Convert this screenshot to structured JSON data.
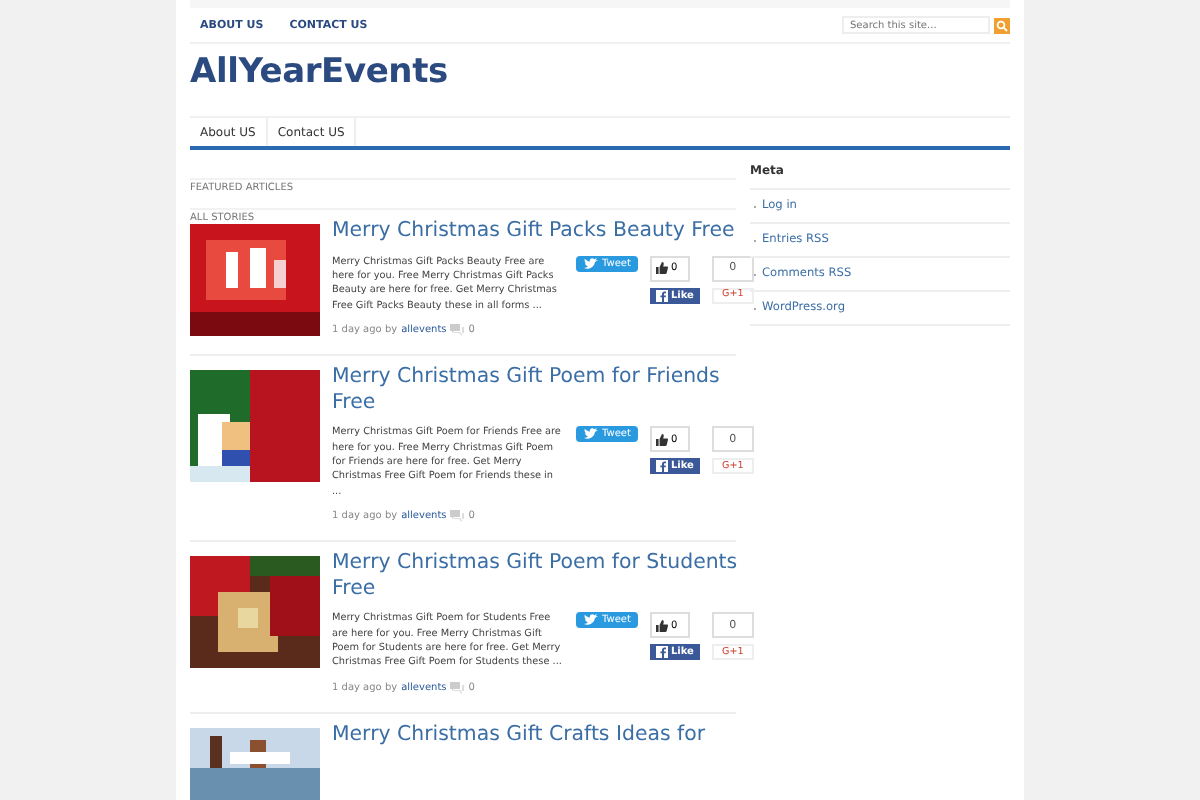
{
  "top_nav": [
    {
      "label": "ABOUT US"
    },
    {
      "label": "CONTACT US"
    }
  ],
  "search": {
    "placeholder": "Search this site..."
  },
  "site_title": "AllYearEvents",
  "menu": [
    {
      "label": "About US"
    },
    {
      "label": "Contact US"
    }
  ],
  "featured_label": "FEATURED ARTICLES",
  "stories_label": "ALL STORIES",
  "posts": [
    {
      "title": "Merry Christmas Gift Packs Beauty Free",
      "excerpt": "Merry Christmas Gift Packs Beauty Free are here for you. Free Merry Christmas Gift Packs Beauty are here for free. Get Merry Christmas Free Gift Packs Beauty these in all forms ...",
      "time": "1 day ago by",
      "author": "allevents",
      "comments": "0",
      "tweet": "Tweet",
      "likes": "0",
      "count": "0",
      "like": "Like",
      "plus": "G+1"
    },
    {
      "title": "Merry Christmas Gift Poem for Friends Free",
      "excerpt": "Merry Christmas Gift Poem for Friends Free are here for you. Free Merry Christmas Gift Poem for Friends are here for free. Get Merry Christmas Free Gift Poem for Friends these in ...",
      "time": "1 day ago by",
      "author": "allevents",
      "comments": "0",
      "tweet": "Tweet",
      "likes": "0",
      "count": "0",
      "like": "Like",
      "plus": "G+1"
    },
    {
      "title": "Merry Christmas Gift Poem for Students Free",
      "excerpt": "Merry Christmas Gift Poem for Students Free are here for you. Free Merry Christmas Gift Poem for Students are here for free. Get Merry Christmas Free Gift Poem for Students these ...",
      "time": "1 day ago by",
      "author": "allevents",
      "comments": "0",
      "tweet": "Tweet",
      "likes": "0",
      "count": "0",
      "like": "Like",
      "plus": "G+1"
    },
    {
      "title": "Merry Christmas Gift Crafts Ideas for"
    }
  ],
  "sidebar": {
    "title": "Meta",
    "links": [
      {
        "label": "Log in"
      },
      {
        "label": "Entries RSS"
      },
      {
        "label": "Comments RSS"
      },
      {
        "label": "WordPress.org"
      }
    ]
  }
}
